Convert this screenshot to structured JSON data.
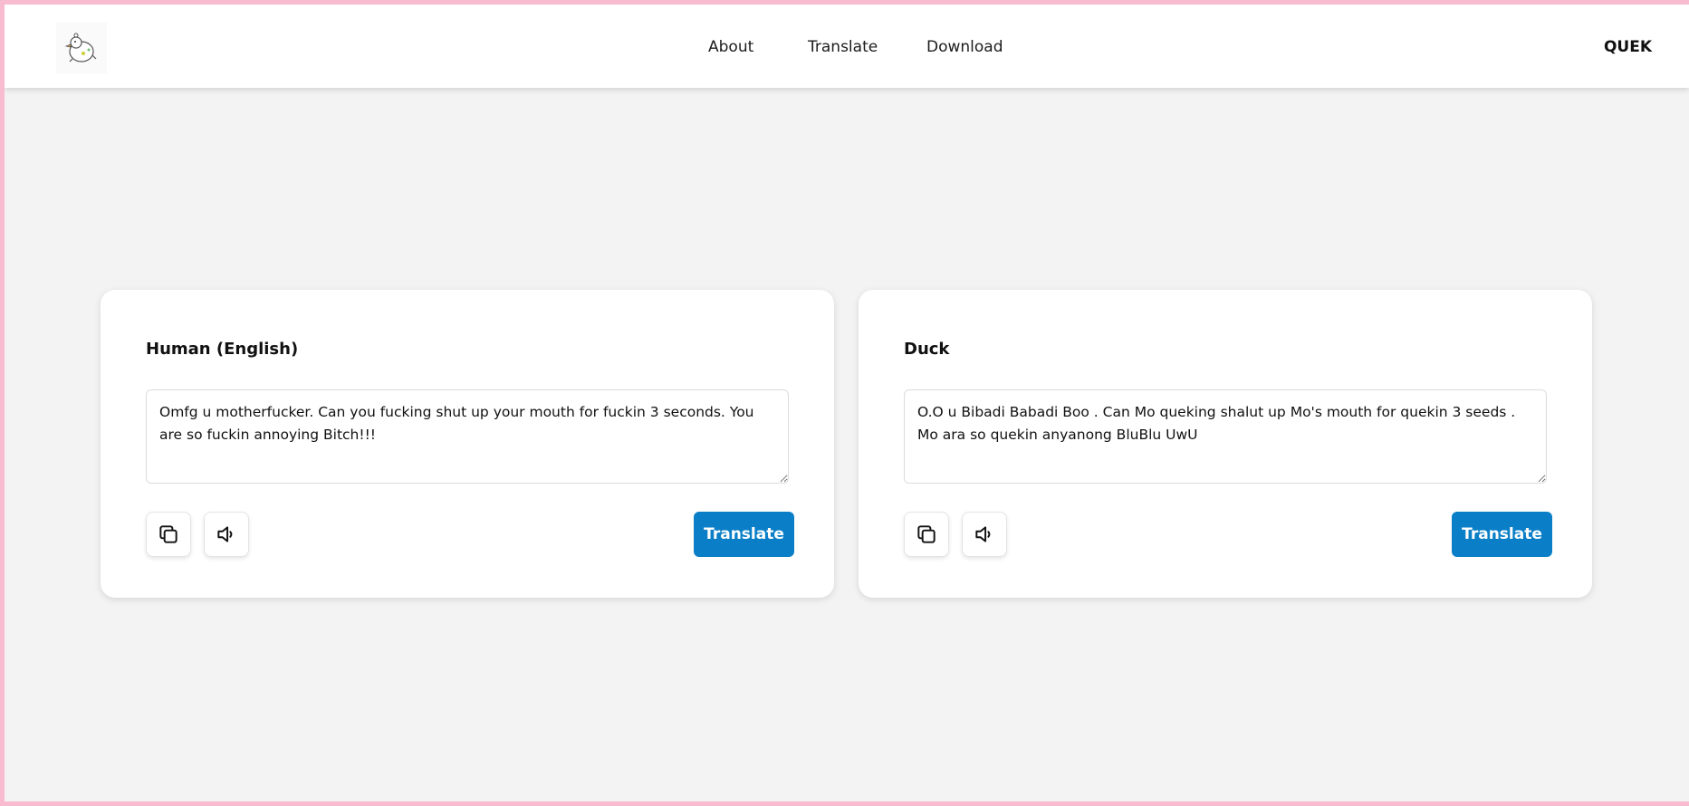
{
  "nav": {
    "links": [
      "About",
      "Translate",
      "Download"
    ],
    "brand": "QUEK",
    "logo_icon": "duck-logo-icon"
  },
  "panels": [
    {
      "title": "Human (English)",
      "text": "Omfg u motherfucker. Can you fucking shut up your mouth for fuckin 3 seconds. You are so fuckin annoying Bitch!!!",
      "copy_icon": "copy-icon",
      "speaker_icon": "speaker-icon",
      "button_label": "Translate"
    },
    {
      "title": "Duck",
      "text": "O.O u Bibadi Babadi Boo . Can Mo queking shalut up Mo's mouth for quekin 3 seeds . Mo ara so quekin anyanong BluBlu UwU",
      "copy_icon": "copy-icon",
      "speaker_icon": "speaker-icon",
      "button_label": "Translate"
    }
  ],
  "colors": {
    "outer_border": "#f8bbd0",
    "background": "#f3f3f3",
    "accent": "#0a7fc7"
  }
}
